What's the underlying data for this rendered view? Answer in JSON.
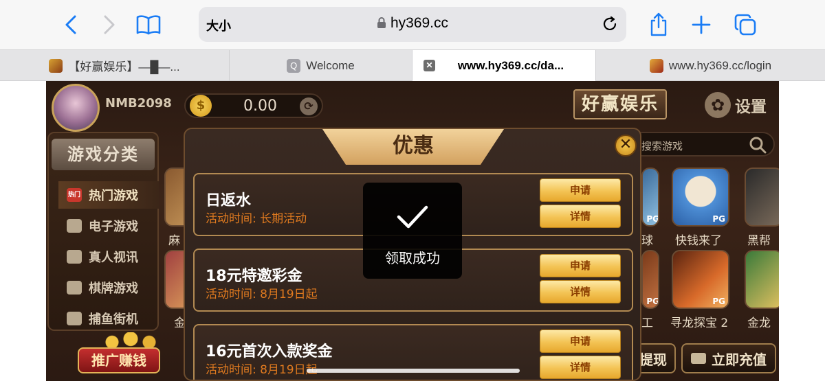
{
  "browser": {
    "text_size_label": "大小",
    "url": "hy369.cc",
    "tabs": [
      {
        "label": "【好赢娱乐】—█—..."
      },
      {
        "label": "Welcome"
      },
      {
        "label": "www.hy369.cc/da..."
      },
      {
        "label": "www.hy369.cc/login"
      }
    ],
    "icons": [
      "back-icon",
      "forward-icon",
      "bookmarks-icon",
      "lock-icon",
      "reload-icon",
      "share-icon",
      "new-tab-icon",
      "tabs-icon"
    ]
  },
  "game": {
    "username": "NMB2098",
    "balance": "0.00",
    "logo": "好赢娱乐",
    "settings_label": "设置",
    "search_placeholder": "搜索游戏",
    "category_title": "游戏分类",
    "categories": [
      {
        "label": "热门游戏",
        "icon_text": "热门"
      },
      {
        "label": "电子游戏"
      },
      {
        "label": "真人视讯"
      },
      {
        "label": "棋牌游戏"
      },
      {
        "label": "捕鱼街机"
      }
    ],
    "promo_button": "推广赚钱",
    "withdraw_button": "提现",
    "recharge_button": "立即充值",
    "game_labels": [
      "麻",
      "金",
      "球",
      "快钱来了",
      "黑帮",
      "工",
      "寻龙探宝 2",
      "金龙"
    ],
    "pg_badge": "PG"
  },
  "modal": {
    "title": "优惠",
    "offers": [
      {
        "name": "日返水",
        "time": "活动时间: 长期活动",
        "apply": "申请",
        "detail": "详情"
      },
      {
        "name": "18元特邀彩金",
        "time": "活动时间: 8月19日起",
        "apply": "申请",
        "detail": "详情"
      },
      {
        "name": "16元首次入款奖金",
        "time": "活动时间: 8月19日起",
        "apply": "申请",
        "detail": "详情"
      }
    ]
  },
  "toast": {
    "text": "领取成功"
  }
}
